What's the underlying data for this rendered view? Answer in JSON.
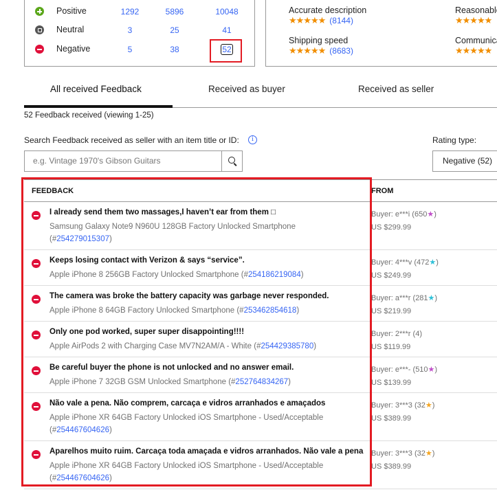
{
  "ratings_summary": {
    "rows": [
      {
        "type": "Positive",
        "icon": "positive-icon",
        "values": [
          "1292",
          "5896",
          "10048"
        ]
      },
      {
        "type": "Neutral",
        "icon": "neutral-icon",
        "values": [
          "3",
          "25",
          "41"
        ]
      },
      {
        "type": "Negative",
        "icon": "negative-icon",
        "values": [
          "5",
          "38",
          "52"
        ]
      }
    ]
  },
  "detailed_ratings": [
    {
      "label": "Accurate description",
      "stars": "★★★★★",
      "count": "(8144)"
    },
    {
      "label": "Reasonable",
      "stars": "★★★★★",
      "count": ""
    },
    {
      "label": "Shipping speed",
      "stars": "★★★★★",
      "count": "(8683)"
    },
    {
      "label": "Communica",
      "stars": "★★★★★",
      "count": ""
    }
  ],
  "tabs": [
    {
      "label": "All received Feedback",
      "active": true
    },
    {
      "label": "Received as buyer",
      "active": false
    },
    {
      "label": "Received as seller",
      "active": false
    }
  ],
  "feedback_count": "52 Feedback received (viewing 1-25)",
  "search": {
    "label": "Search Feedback received as seller with an item title or ID:",
    "info_icon": "i",
    "placeholder": "e.g. Vintage 1970's Gibson Guitars"
  },
  "rating_type": {
    "label": "Rating type:",
    "selected": "Negative (52)"
  },
  "table": {
    "headers": [
      "FEEDBACK",
      "FROM"
    ],
    "rows": [
      {
        "comment": "I already send them two massages,I haven’t ear from them □",
        "item": "Samsung Galaxy Note9 N960U 128GB Factory Unlocked Smartphone",
        "item_prefix": "(#",
        "item_id": "254279015307",
        "item_suffix": ")",
        "buyer": "Buyer: e***i (650",
        "star": "★",
        "star_color": "#c04fc9",
        "buyer_close": ")",
        "price": "US $299.99"
      },
      {
        "comment": "Keeps losing contact with Verizon & says “service”.",
        "item": "Apple iPhone 8 256GB Factory Unlocked Smartphone",
        "item_prefix": "(#",
        "item_id": "254186219084",
        "item_suffix": ")",
        "buyer": "Buyer: 4***v (472",
        "star": "★",
        "star_color": "#2fc1d8",
        "buyer_close": ")",
        "price": "US $249.99"
      },
      {
        "comment": "The camera was broke the battery capacity was garbage never responded.",
        "item": "Apple iPhone 8 64GB Factory Unlocked Smartphone",
        "item_prefix": "(#",
        "item_id": "253462854618",
        "item_suffix": ")",
        "buyer": "Buyer: a***r (281",
        "star": "★",
        "star_color": "#2fc1d8",
        "buyer_close": ")",
        "price": "US $219.99"
      },
      {
        "comment": "Only one pod worked, super super disappointing!!!!",
        "item": "Apple AirPods 2 with Charging Case MV7N2AM/A - White",
        "item_prefix": "(#",
        "item_id": "254429385780",
        "item_suffix": ")",
        "buyer": "Buyer: 2***r (4",
        "star": "",
        "star_color": "",
        "buyer_close": ")",
        "price": "US $119.99"
      },
      {
        "comment": "Be careful buyer the phone is not unlocked and no answer email.",
        "item": "Apple iPhone 7 32GB GSM Unlocked Smartphone",
        "item_prefix": "(#",
        "item_id": "252764834267",
        "item_suffix": ")",
        "buyer": "Buyer: e***- (510",
        "star": "★",
        "star_color": "#c04fc9",
        "buyer_close": ")",
        "price": "US $139.99"
      },
      {
        "comment": "Não vale a pena. Não comprem, carcaça e vidros arranhados e amaçados",
        "item": "Apple iPhone XR 64GB Factory Unlocked iOS Smartphone - Used/Acceptable",
        "item_prefix": "(#",
        "item_id": "254467604626",
        "item_suffix": ")",
        "buyer": "Buyer: 3***3 (32",
        "star": "★",
        "star_color": "#f5a623",
        "buyer_close": ")",
        "price": "US $389.99"
      },
      {
        "comment": "Aparelhos muito ruim. Carcaça toda amaçada e vidros arranhados. Não vale a pena",
        "item": "Apple iPhone XR 64GB Factory Unlocked iOS Smartphone - Used/Acceptable",
        "item_prefix": "(#",
        "item_id": "254467604626",
        "item_suffix": ")",
        "buyer": "Buyer: 3***3 (32",
        "star": "★",
        "star_color": "#f5a623",
        "buyer_close": ")",
        "price": "US $389.99"
      }
    ]
  },
  "colors": {
    "link": "#3665f3",
    "positive": "#5ba71b",
    "neutral": "#555555",
    "negative": "#e0103a",
    "star": "#f18e00",
    "highlight": "#e31b23"
  }
}
